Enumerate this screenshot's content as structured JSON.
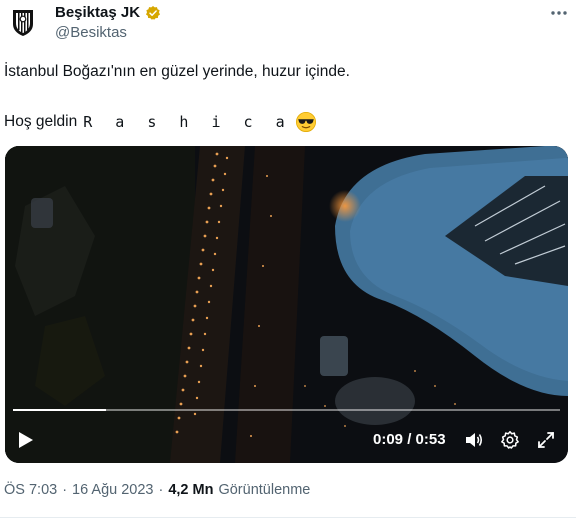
{
  "account": {
    "name": "Beşiktaş JK",
    "handle": "@Besiktas",
    "verified": true,
    "verified_color": "#d6a700",
    "avatar_icon": "besiktas-logo-icon"
  },
  "tweet": {
    "line1": "İstanbul Boğazı'nın en güzel yerinde, huzur içinde.",
    "line2_prefix": "Hoş geldin",
    "line2_name": "R a s h i c a",
    "emoji": "smiling-face-with-sunglasses"
  },
  "video": {
    "current_time": "0:09",
    "separator": "/",
    "duration": "0:53",
    "progress_fraction": 0.17
  },
  "meta": {
    "time": "ÖS 7:03",
    "dot": "·",
    "date": "16 Ağu 2023",
    "views": "4,2 Mn",
    "views_label": "Görüntülenme"
  }
}
